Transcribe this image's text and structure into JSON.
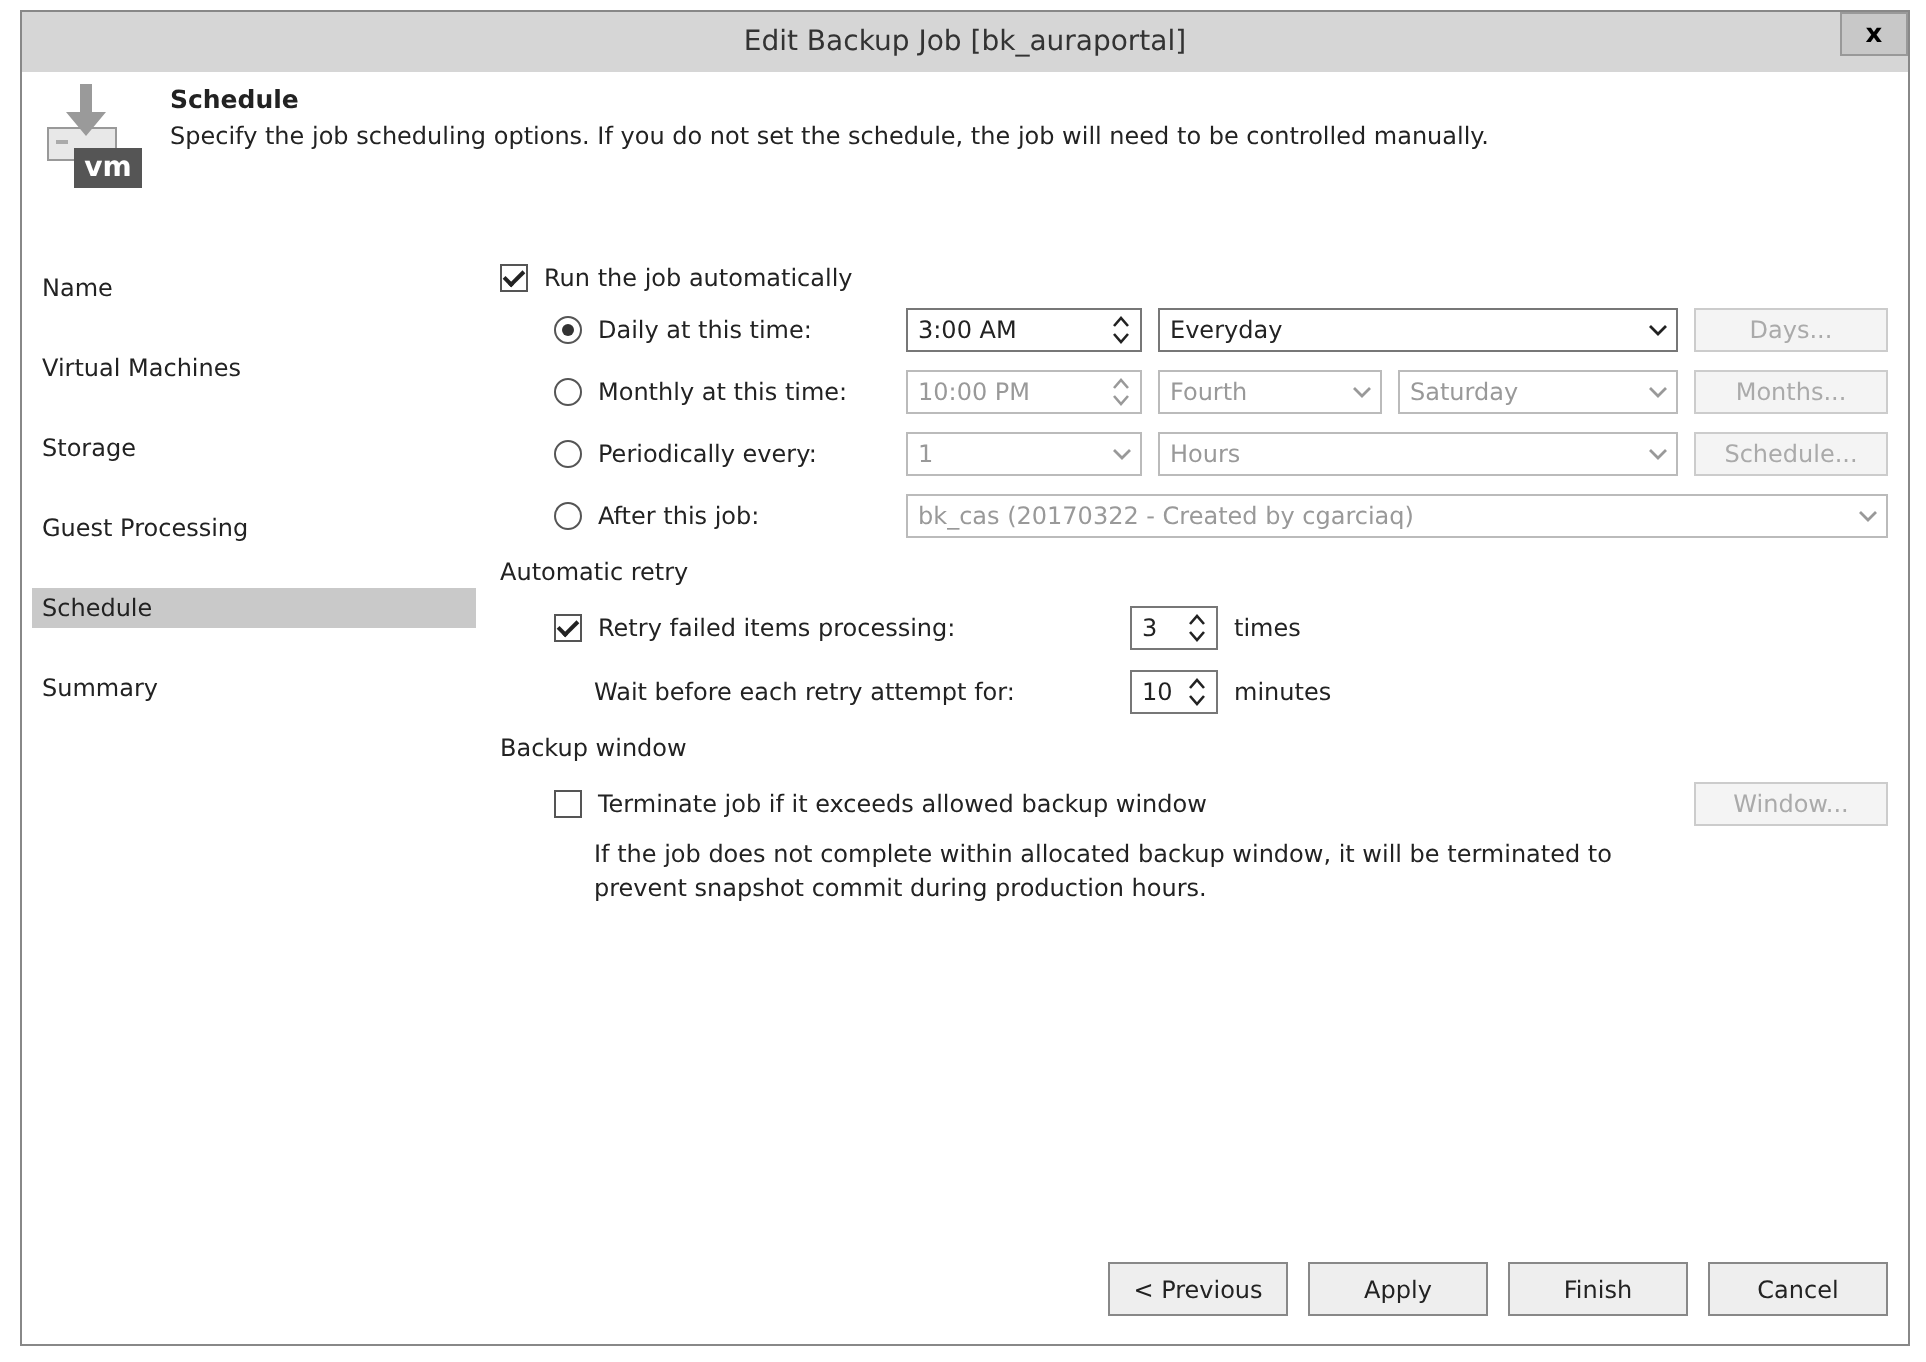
{
  "window": {
    "title": "Edit Backup Job [bk_auraportal]",
    "close": "x"
  },
  "header": {
    "title": "Schedule",
    "description": "Specify the job scheduling options. If you do not set the schedule, the job will need to be controlled manually.",
    "icon_text": "vm"
  },
  "nav": [
    {
      "label": "Name",
      "selected": false
    },
    {
      "label": "Virtual Machines",
      "selected": false
    },
    {
      "label": "Storage",
      "selected": false
    },
    {
      "label": "Guest Processing",
      "selected": false
    },
    {
      "label": "Schedule",
      "selected": true
    },
    {
      "label": "Summary",
      "selected": false
    }
  ],
  "run_automatically": {
    "label": "Run the job automatically",
    "checked": true
  },
  "schedule_options": [
    {
      "label": "Daily at this time:",
      "selected": true,
      "controls": [
        {
          "kind": "spinner",
          "value": "3:00 AM",
          "disabled": false
        },
        {
          "kind": "dropdown",
          "value": "Everyday",
          "disabled": false
        },
        {
          "kind": "button",
          "value": "Days...",
          "disabled": true
        }
      ]
    },
    {
      "label": "Monthly at this time:",
      "selected": false,
      "controls": [
        {
          "kind": "spinner",
          "value": "10:00 PM",
          "disabled": true
        },
        {
          "kind": "dropdown",
          "value": "Fourth",
          "disabled": true
        },
        {
          "kind": "dropdown",
          "value": "Saturday",
          "disabled": true
        },
        {
          "kind": "button",
          "value": "Months...",
          "disabled": true
        }
      ]
    },
    {
      "label": "Periodically every:",
      "selected": false,
      "controls": [
        {
          "kind": "dropdown",
          "value": "1",
          "disabled": true
        },
        {
          "kind": "dropdown",
          "value": "Hours",
          "disabled": true
        },
        {
          "kind": "button",
          "value": "Schedule...",
          "disabled": true
        }
      ]
    },
    {
      "label": "After this job:",
      "selected": false,
      "controls": [
        {
          "kind": "dropdown",
          "value": "bk_cas (20170322 - Created by cgarciaq)",
          "disabled": true
        }
      ]
    }
  ],
  "automatic_retry": {
    "heading": "Automatic retry",
    "retry": {
      "label": "Retry failed items processing:",
      "checked": true,
      "value": "3",
      "unit": "times"
    },
    "wait": {
      "label": "Wait before each retry attempt for:",
      "value": "10",
      "unit": "minutes"
    }
  },
  "backup_window": {
    "heading": "Backup window",
    "label": "Terminate job if it exceeds allowed backup window",
    "checked": false,
    "button": "Window...",
    "button_disabled": true,
    "note": "If the job does not complete within allocated backup window, it will be terminated to prevent snapshot commit during production hours."
  },
  "buttons": [
    "< Previous",
    "Apply",
    "Finish",
    "Cancel"
  ]
}
